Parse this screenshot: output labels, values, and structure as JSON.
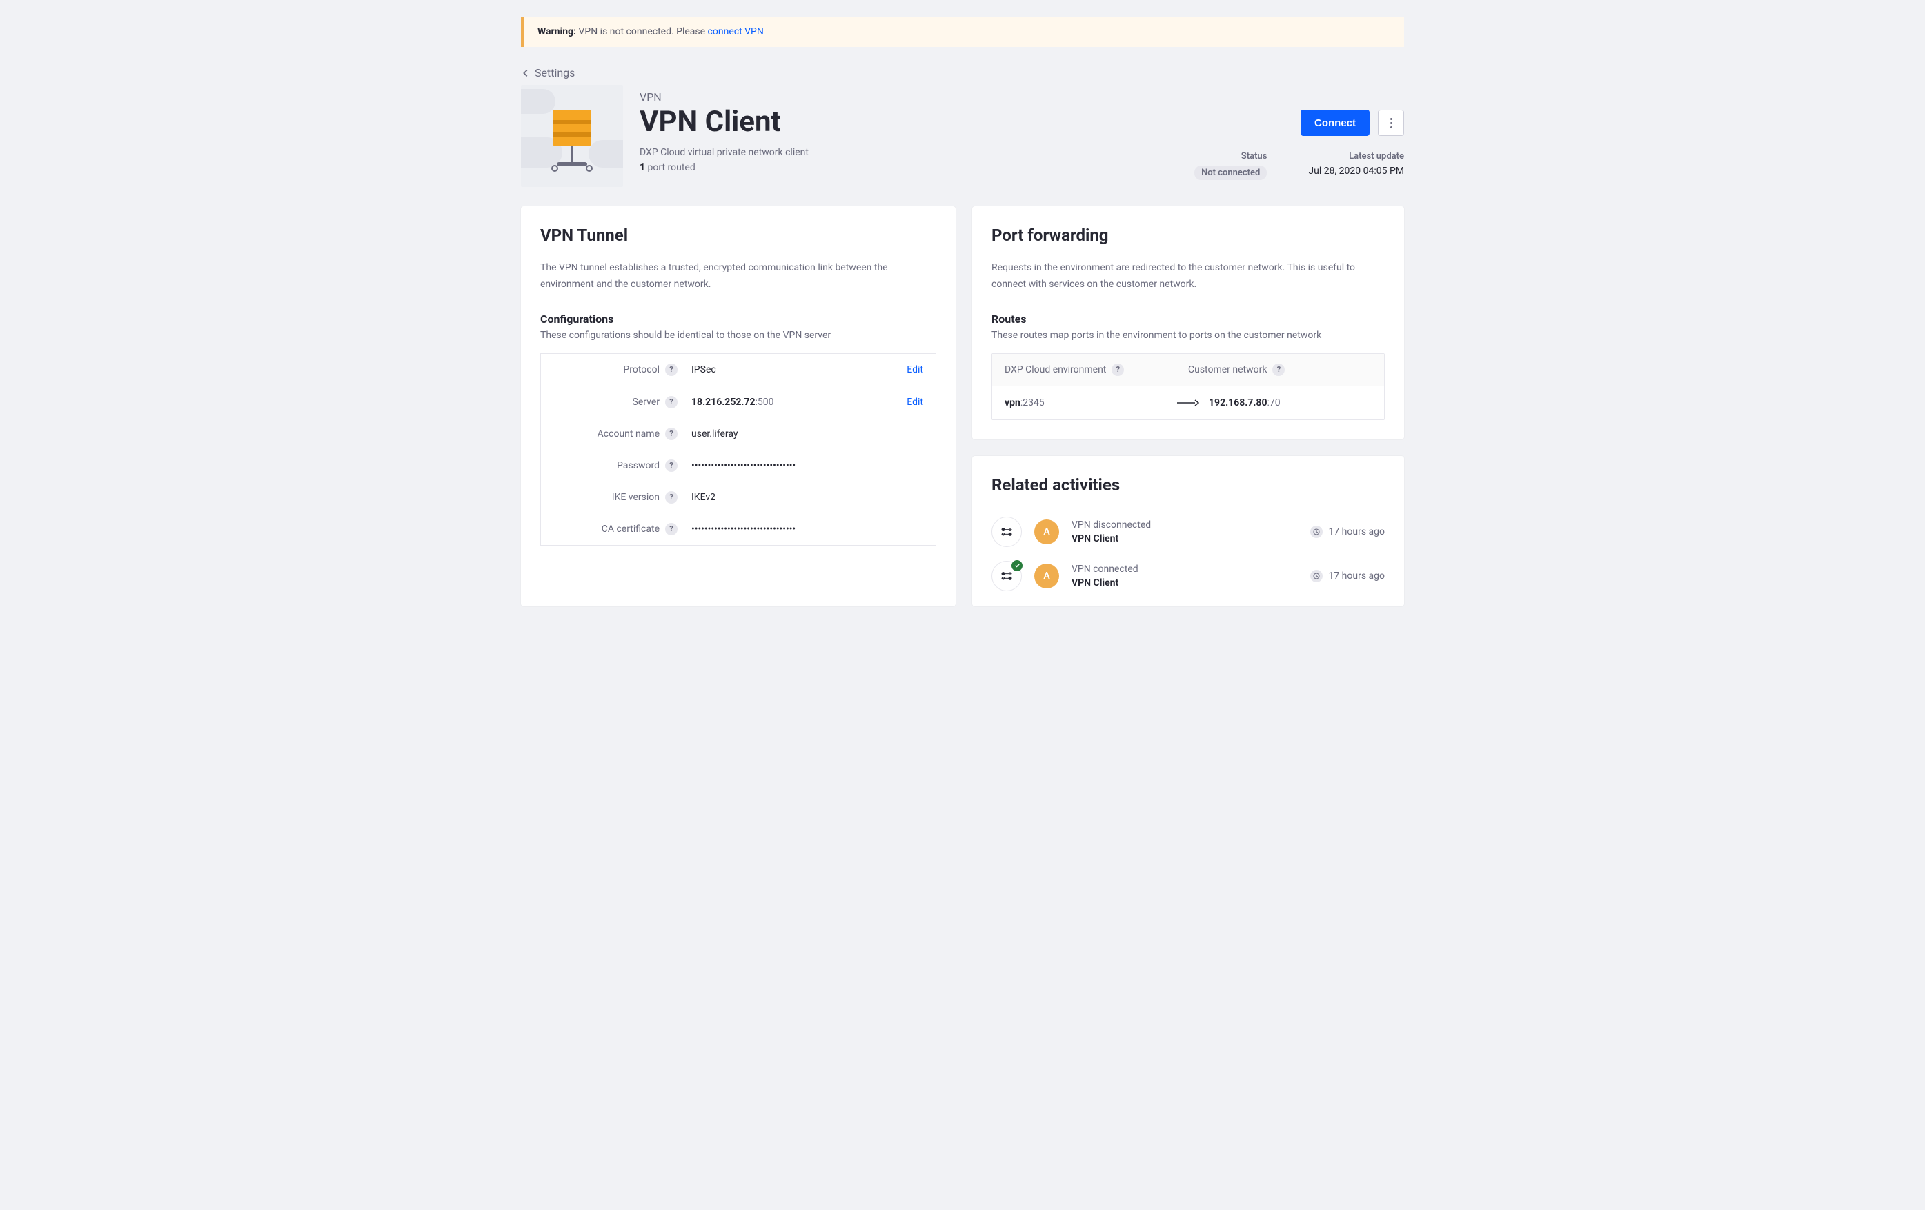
{
  "warning": {
    "prefix": "Warning:",
    "text": " VPN is not connected. Please ",
    "link": "connect VPN"
  },
  "breadcrumb": "Settings",
  "header": {
    "eyebrow": "VPN",
    "title": "VPN Client",
    "subtitle": "DXP Cloud virtual private network client",
    "port_count": "1",
    "port_routed_suffix": " port routed",
    "connect_button": "Connect",
    "status_label": "Status",
    "status_value": "Not connected",
    "update_label": "Latest update",
    "update_value": "Jul 28, 2020 04:05 PM"
  },
  "tunnel": {
    "title": "VPN Tunnel",
    "desc": "The VPN tunnel establishes a trusted, encrypted communication link between the environment and the customer network.",
    "config_title": "Configurations",
    "config_sub": "These configurations should be identical to those on the VPN server",
    "edit": "Edit",
    "rows": {
      "protocol_label": "Protocol",
      "protocol_value": "IPSec",
      "server_label": "Server",
      "server_ip": "18.216.252.72",
      "server_port": ":500",
      "account_label": "Account name",
      "account_value": "user.liferay",
      "password_label": "Password",
      "password_value": "••••••••••••••••••••••••••••••••",
      "ike_label": "IKE version",
      "ike_value": "IKEv2",
      "ca_label": "CA certificate",
      "ca_value": "••••••••••••••••••••••••••••••••"
    }
  },
  "portforward": {
    "title": "Port forwarding",
    "desc": "Requests in the environment are redirected to the customer network. This is useful to connect with services on the customer network.",
    "routes_title": "Routes",
    "routes_sub": "These routes map ports in the environment to ports on the customer network",
    "col1": "DXP Cloud environment",
    "col2": "Customer network",
    "row": {
      "env_name": "vpn",
      "env_port": ":2345",
      "cust_ip": "192.168.7.80",
      "cust_port": ":70"
    }
  },
  "activities": {
    "title": "Related activities",
    "items": [
      {
        "event": "VPN disconnected",
        "target": "VPN Client",
        "avatar": "A",
        "time": "17 hours ago",
        "connected": false
      },
      {
        "event": "VPN connected",
        "target": "VPN Client",
        "avatar": "A",
        "time": "17 hours ago",
        "connected": true
      }
    ]
  }
}
